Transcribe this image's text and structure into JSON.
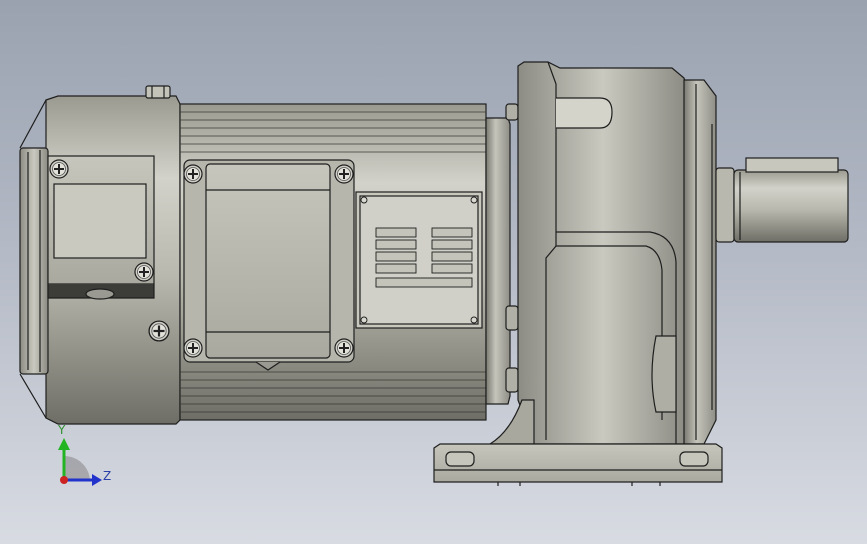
{
  "axis_triad": {
    "y_label": "Y",
    "z_label": "Z",
    "y_color": "#22b422",
    "z_color": "#2233cc",
    "origin_color": "#cc2222"
  },
  "colors": {
    "background_top": "#9aa2b0",
    "background_bottom": "#d8dbe2",
    "body_light": "#d6d6ce",
    "body_mid": "#b4b4aa",
    "body_dark": "#75756d",
    "outline": "#1e1e1e"
  },
  "icons": [
    "phillips-screw-icon",
    "axis-triad-icon"
  ]
}
